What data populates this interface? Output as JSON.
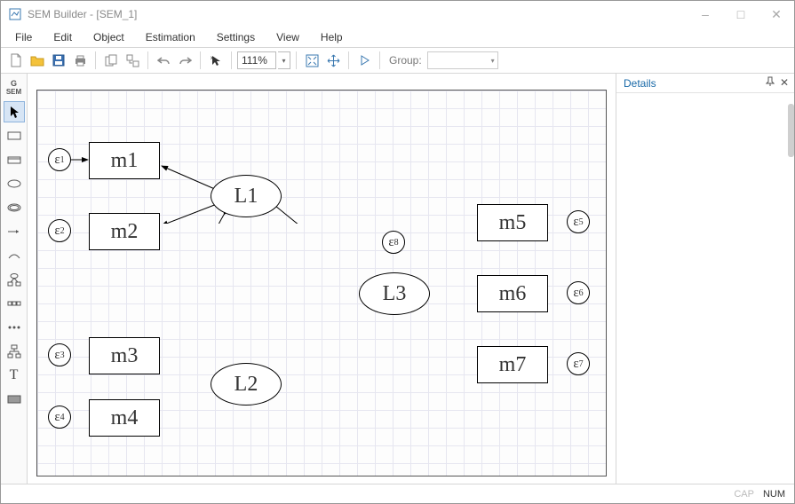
{
  "window": {
    "title": "SEM Builder - [SEM_1]"
  },
  "menu": {
    "file": "File",
    "edit": "Edit",
    "object": "Object",
    "estimation": "Estimation",
    "settings": "Settings",
    "view": "View",
    "help": "Help"
  },
  "toolbar": {
    "zoom": "111%",
    "group_label": "Group:",
    "group_value": ""
  },
  "details": {
    "title": "Details"
  },
  "status": {
    "cap": "CAP",
    "num": "NUM"
  },
  "nodes": {
    "m1": "m1",
    "m2": "m2",
    "m3": "m3",
    "m4": "m4",
    "m5": "m5",
    "m6": "m6",
    "m7": "m7",
    "L1": "L1",
    "L2": "L2",
    "L3": "L3",
    "e1": "ε",
    "e2": "ε",
    "e3": "ε",
    "e4": "ε",
    "e5": "ε",
    "e6": "ε",
    "e7": "ε",
    "e8": "ε",
    "s1": "1",
    "s2": "2",
    "s3": "3",
    "s4": "4",
    "s5": "5",
    "s6": "6",
    "s7": "7",
    "s8": "8"
  },
  "_model_structure_comment": "SEM path diagram. Latent variables L1, L2, L3 (ellipses). Observed indicators m1–m7 (boxes) each with error term ε1–ε7. L3 has disturbance ε8. Paths: L1→m1, L1→m2, L2→m3, L2→m4, L3→m5, L3→m6, L3→m7. Structural: L1→L3, L2→L3. Covariance: L1↔L2 (curved double-headed)."
}
